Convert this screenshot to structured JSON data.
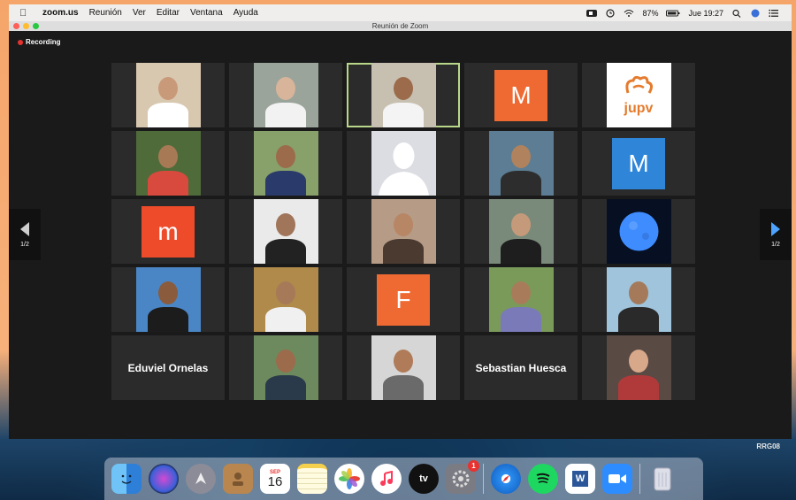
{
  "menubar": {
    "app_name": "zoom.us",
    "menus": [
      "Reunión",
      "Ver",
      "Editar",
      "Ventana",
      "Ayuda"
    ],
    "battery": "87%",
    "clock": "Jue 19:27"
  },
  "window": {
    "title": "Reunión de Zoom",
    "recording_label": "Recording"
  },
  "pagination": {
    "left_page": "1/2",
    "right_page": "1/2"
  },
  "participants": [
    {
      "type": "photo",
      "bg": "#d9c8b0",
      "skin": "#c99a7a",
      "shirt": "#ffffff"
    },
    {
      "type": "photo",
      "bg": "#9aa49a",
      "skin": "#d8b49a",
      "shirt": "#f2f2f2"
    },
    {
      "type": "photo",
      "bg": "#c7c0b0",
      "skin": "#9b6b4c",
      "shirt": "#f4f4f4",
      "active": true
    },
    {
      "type": "initial",
      "text": "M",
      "color": "#ee6a32"
    },
    {
      "type": "logo",
      "text": "jupv",
      "color": "#e57b2e"
    },
    {
      "type": "photo",
      "bg": "#4f6b3a",
      "skin": "#a77a55",
      "shirt": "#d84a3e"
    },
    {
      "type": "photo",
      "bg": "#88a06a",
      "skin": "#9b6b4c",
      "shirt": "#2a3a6a"
    },
    {
      "type": "silhouette"
    },
    {
      "type": "photo",
      "bg": "#5c7d93",
      "skin": "#b0825e",
      "shirt": "#2d2d2d"
    },
    {
      "type": "initial",
      "text": "M",
      "color": "#2f86d9"
    },
    {
      "type": "initial",
      "text": "m",
      "color": "#ee4b2b"
    },
    {
      "type": "photo",
      "bg": "#eaeaea",
      "skin": "#a0755a",
      "shirt": "#222222"
    },
    {
      "type": "photo",
      "bg": "#b69c86",
      "skin": "#b78665",
      "shirt": "#4a3a30"
    },
    {
      "type": "photo",
      "bg": "#7a8a7a",
      "skin": "#c59a7a",
      "shirt": "#1e1e1e"
    },
    {
      "type": "moon"
    },
    {
      "type": "photo",
      "bg": "#4a86c6",
      "skin": "#8a5b3c",
      "shirt": "#1c1c1c"
    },
    {
      "type": "photo",
      "bg": "#b08a4a",
      "skin": "#a67a58",
      "shirt": "#f0f0f0"
    },
    {
      "type": "initial",
      "text": "F",
      "color": "#ee6a32"
    },
    {
      "type": "photo",
      "bg": "#7a9a5a",
      "skin": "#a87c5a",
      "shirt": "#7a7ab8"
    },
    {
      "type": "photo",
      "bg": "#9fc4dc",
      "skin": "#a47a5a",
      "shirt": "#2a2a2a"
    },
    {
      "type": "name",
      "text": "Eduviel Ornelas"
    },
    {
      "type": "photo",
      "bg": "#6d8a5e",
      "skin": "#9b6b4c",
      "shirt": "#2b3a4a"
    },
    {
      "type": "photo",
      "bg": "#d6d6d6",
      "skin": "#b07b58",
      "shirt": "#6a6a6a"
    },
    {
      "type": "name",
      "text": "Sebastian Huesca"
    },
    {
      "type": "photo",
      "bg": "#5a4a44",
      "skin": "#d8a88a",
      "shirt": "#b03a3a"
    }
  ],
  "corner_label": "RRG08",
  "dock": {
    "calendar_month": "SEP",
    "calendar_day": "16",
    "tv_label": "tv",
    "word_label": "W",
    "settings_badge": "1",
    "icons": [
      "finder-icon",
      "siri-icon",
      "launchpad-icon",
      "contacts-icon",
      "calendar-icon",
      "notes-icon",
      "photos-icon",
      "music-icon",
      "apple-tv-icon",
      "system-preferences-icon",
      "safari-icon",
      "spotify-icon",
      "word-icon",
      "zoom-icon",
      "trash-icon"
    ]
  }
}
